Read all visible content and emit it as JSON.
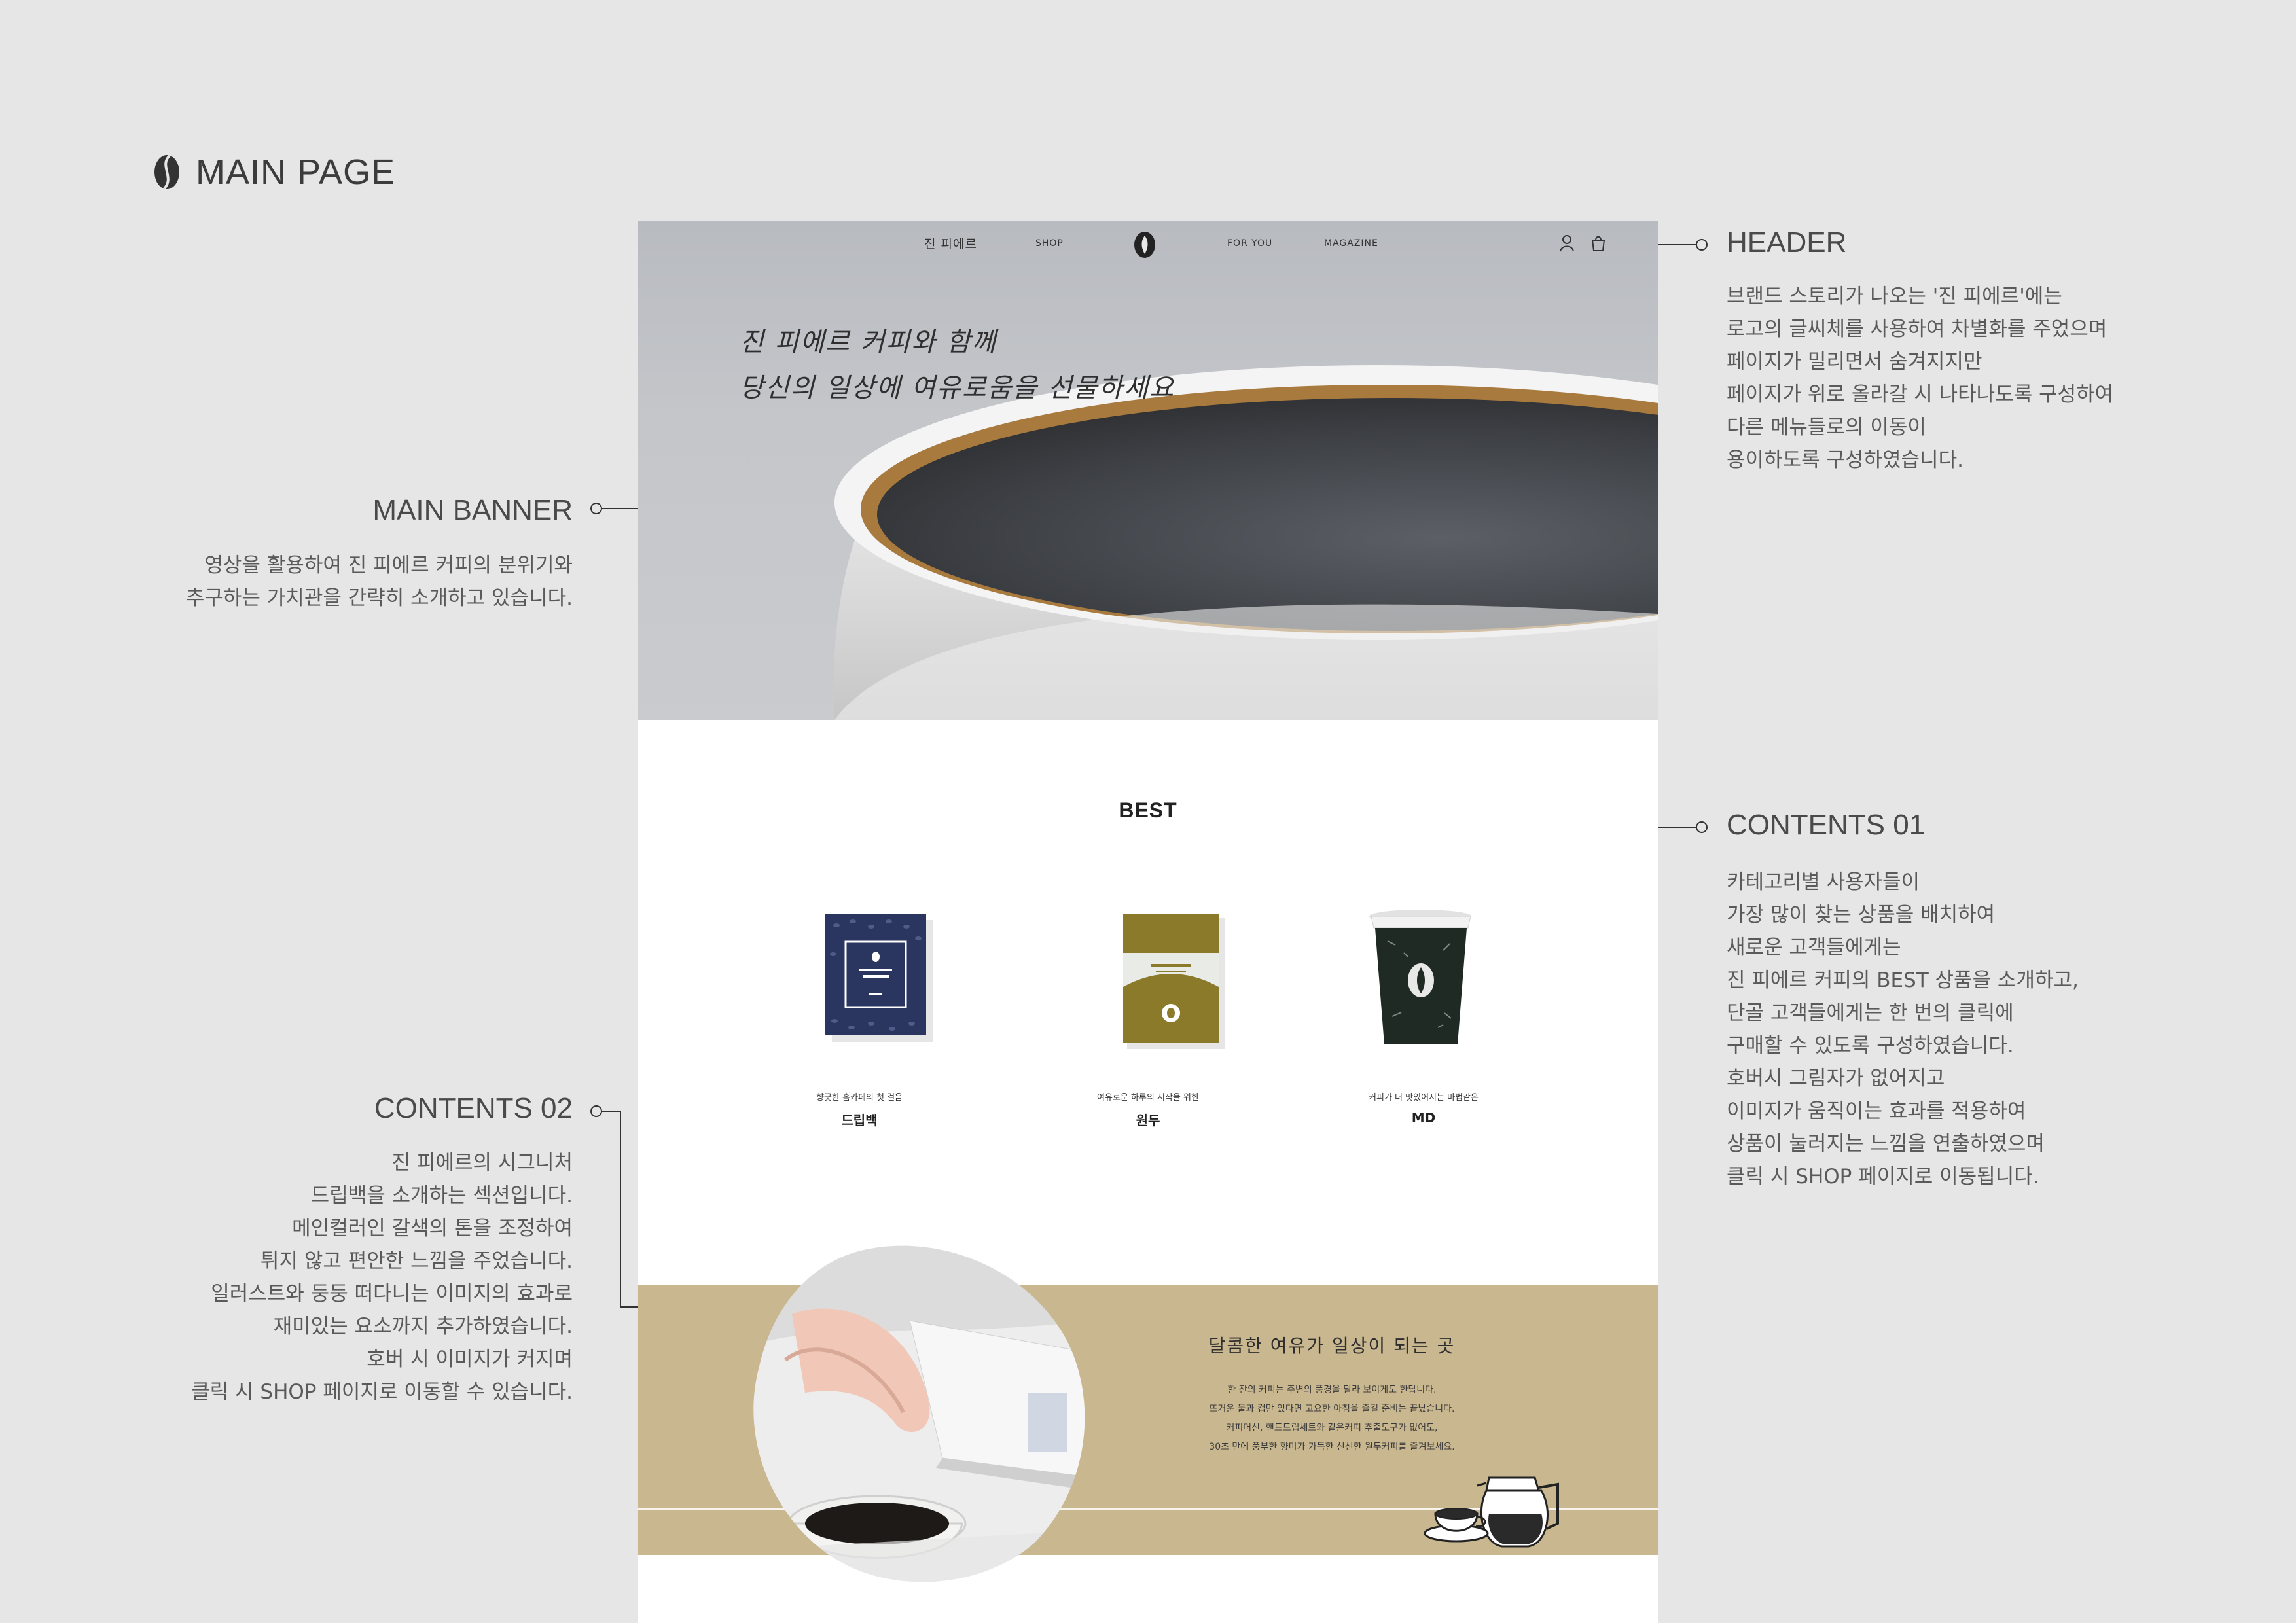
{
  "page_heading": {
    "title": "MAIN PAGE",
    "icon": "coffee-bean-icon"
  },
  "annotations": {
    "header": {
      "title": "HEADER",
      "lines": [
        "브랜드 스토리가 나오는 '진 피에르'에는",
        "로고의 글씨체를 사용하여 차별화를 주었으며",
        "페이지가 밀리면서 숨겨지지만",
        "페이지가 위로 올라갈 시 나타나도록 구성하여",
        "다른 메뉴들로의 이동이",
        "용이하도록 구성하였습니다."
      ]
    },
    "main_banner": {
      "title": "MAIN BANNER",
      "lines": [
        "영상을 활용하여 진 피에르 커피의 분위기와",
        "추구하는 가치관을 간략히 소개하고 있습니다."
      ]
    },
    "contents_01": {
      "title": "CONTENTS 01",
      "lines": [
        "카테고리별 사용자들이",
        "가장 많이 찾는 상품을 배치하여",
        "새로운 고객들에게는",
        "진 피에르 커피의 BEST 상품을 소개하고,",
        "단골 고객들에게는 한 번의 클릭에",
        "구매할 수 있도록 구성하였습니다.",
        "호버시 그림자가 없어지고",
        "이미지가 움직이는 효과를 적용하여",
        "상품이 눌러지는 느낌을 연출하였으며",
        "클릭 시 SHOP 페이지로 이동됩니다."
      ]
    },
    "contents_02": {
      "title": "CONTENTS 02",
      "lines": [
        "진 피에르의 시그니처",
        "드립백을 소개하는 섹션입니다.",
        "메인컬러인 갈색의 톤을 조정하여",
        "튀지 않고 편안한 느낌을 주었습니다.",
        "일러스트와 둥둥 떠다니는 이미지의 효과로",
        "재미있는 요소까지 추가하였습니다.",
        "호버 시 이미지가 커지며",
        "클릭 시 SHOP 페이지로 이동할 수 있습니다."
      ]
    }
  },
  "site": {
    "nav": {
      "story": "진 피에르",
      "shop": "SHOP",
      "for_you": "FOR YOU",
      "magazine": "MAGAZINE"
    },
    "header_icons": [
      "user-icon",
      "cart-icon"
    ],
    "banner": {
      "lines": [
        "진 피에르 커피와 함께",
        "당신의 일상에 여유로움을 선물하세요"
      ]
    },
    "best": {
      "title": "BEST",
      "products": [
        {
          "subtitle": "향긋한 홈카페의 첫 걸음",
          "name": "드립백"
        },
        {
          "subtitle": "여유로운 하루의 시작을 위한",
          "name": "원두"
        },
        {
          "subtitle": "커피가 더 맛있어지는 마법같은",
          "name": "MD"
        }
      ]
    },
    "story": {
      "heading": "달콤한 여유가 일상이 되는 곳",
      "lines": [
        "한 잔의 커피는 주변의 풍경을 달라 보이게도 한답니다.",
        "뜨거운 물과 컵만 있다면 고요한 아침을 즐길 준비는 끝났습니다.",
        "커피머신, 핸드드립세트와 같은커피 추출도구가 없어도,",
        "30초 만에 풍부한 향미가 가득한 신선한 원두커피를 즐겨보세요."
      ]
    }
  },
  "colors": {
    "page_background": "#e6e6e6",
    "story_band": "#c9b78f",
    "dripbag_navy": "#2a3560",
    "bean_bag_olive": "#8a7a2a",
    "md_cup_green": "#1f2a24"
  }
}
